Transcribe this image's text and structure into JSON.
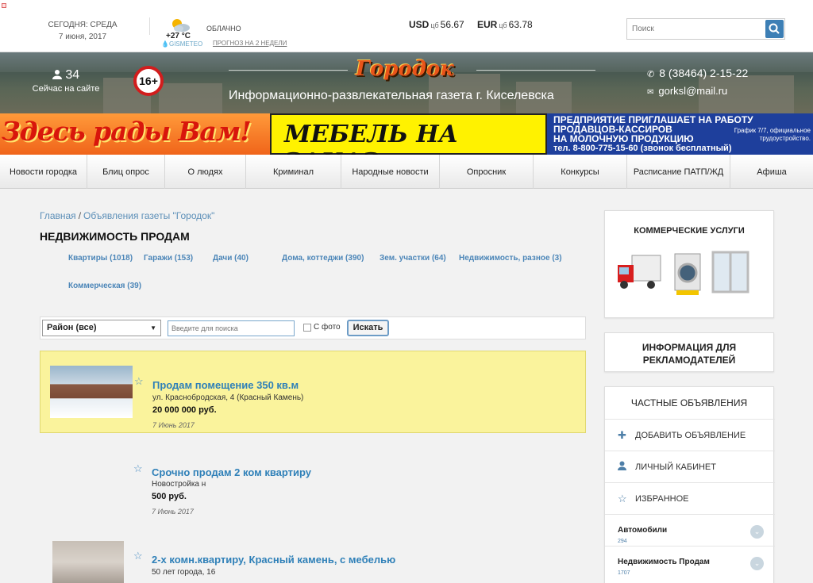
{
  "topbar": {
    "today_label": "СЕГОДНЯ: СРЕДА",
    "date": "7 июня, 2017",
    "temperature": "+27 °C",
    "weather_provider": "GISMETEO",
    "weather_condition": "ОБЛАЧНО",
    "forecast_link": "ПРОГНОЗ НА 2 НЕДЕЛИ",
    "usd_label": "USD",
    "usd_cb": "цб",
    "usd_value": "56.67",
    "eur_label": "EUR",
    "eur_cb": "цб",
    "eur_value": "63.78",
    "search_placeholder": "Поиск"
  },
  "header": {
    "online_count": "34",
    "online_label": "Сейчас на сайте",
    "age_rating": "16+",
    "logo_text": "Городок",
    "tagline": "Информационно-развлекательная газета г. Киселевска",
    "phone": "8 (38464) 2-15-22",
    "email": "gorksl@mail.ru"
  },
  "ads": {
    "ad1": "Здесь рады Вам!",
    "ad2": "МЕБЕЛЬ НА ЗАКАЗ",
    "ad3_line1": "ПРЕДПРИЯТИЕ ПРИГЛАШАЕТ НА РАБОТУ",
    "ad3_line2": "ПРОДАВЦОВ-КАССИРОВ",
    "ad3_line3": "НА МОЛОЧНУЮ ПРОДУКЦИЮ",
    "ad3_schedule": "График 7/7, официальное трудоустройство.",
    "ad3_phone": "тел. 8-800-775-15-60 (звонок бесплатный)"
  },
  "nav": [
    "Новости городка",
    "Блиц опрос",
    "О людях",
    "Криминал",
    "Народные новости",
    "Опросник",
    "Конкурсы",
    "Расписание ПАТП/ЖД",
    "Афиша"
  ],
  "breadcrumb": {
    "home": "Главная",
    "separator": "/",
    "section": "Объявления газеты \"Городок\""
  },
  "page_title": "НЕДВИЖИМОСТЬ ПРОДАМ",
  "categories": [
    "Квартиры (1018)",
    "Гаражи (153)",
    "Дачи (40)",
    "Дома, коттеджи (390)",
    "Зем. участки (64)",
    "Недвижимость, разное (3)",
    "Коммерческая (39)"
  ],
  "filter": {
    "district": "Район (все)",
    "keyword_placeholder": "Введите для поиска",
    "photo_label": "С фото",
    "submit": "Искать"
  },
  "listings": [
    {
      "title": "Продам помещение 350 кв.м",
      "address": "ул. Краснобродская, 4 (Красный Камень)",
      "price": "20 000 000 руб.",
      "date": "7 Июнь 2017"
    },
    {
      "title": "Срочно продам 2 ком квартиру",
      "address": "Новостройка н",
      "price": "500 руб.",
      "date": "7 Июнь 2017"
    },
    {
      "title": "2-х комн.квартиру, Красный камень, с мебелью",
      "address": "50 лет города, 16",
      "price": "",
      "date": ""
    }
  ],
  "sidebar": {
    "commercial_title": "КОММЕРЧЕСКИЕ УСЛУГИ",
    "advertisers_title": "ИНФОРМАЦИЯ ДЛЯ РЕКЛАМОДАТЕЛЕЙ",
    "private_title": "ЧАСТНЫЕ ОБЪЯВЛЕНИЯ",
    "add_ad": "ДОБАВИТЬ ОБЪЯВЛЕНИЕ",
    "cabinet": "ЛИЧНЫЙ КАБИНЕТ",
    "favorites": "ИЗБРАННОЕ",
    "cats": [
      {
        "name": "Автомобили",
        "count": "294"
      },
      {
        "name": "Недвижимость Продам",
        "count": "1707"
      }
    ]
  },
  "colors": {
    "link": "#2f80b8",
    "highlight": "#faf39c",
    "accent": "#3d7fb5"
  }
}
